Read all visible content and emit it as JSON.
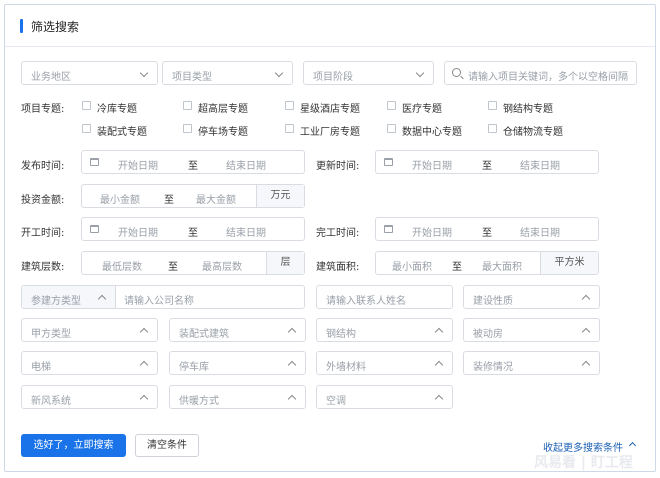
{
  "panel": {
    "title": "筛选搜索"
  },
  "top_selects": {
    "region": "业务地区",
    "project_type": "项目类型",
    "project_stage": "项目阶段"
  },
  "keyword_search": {
    "placeholder": "请输入项目关键词，多个以空格间隔"
  },
  "topics": {
    "label": "项目专题:",
    "items": [
      "冷库专题",
      "超高层专题",
      "星级酒店专题",
      "医疗专题",
      "钢结构专题",
      "装配式专题",
      "停车场专题",
      "工业厂房专题",
      "数据中心专题",
      "仓储物流专题"
    ]
  },
  "publish_time": {
    "label": "发布时间:",
    "start": "开始日期",
    "sep": "至",
    "end": "结束日期"
  },
  "update_time": {
    "label": "更新时间:",
    "start": "开始日期",
    "sep": "至",
    "end": "结束日期"
  },
  "investment": {
    "label": "投资金额:",
    "min": "最小金额",
    "sep": "至",
    "max": "最大金额",
    "unit": "万元"
  },
  "start_time": {
    "label": "开工时间:",
    "start": "开始日期",
    "sep": "至",
    "end": "结束日期"
  },
  "finish_time": {
    "label": "完工时间:",
    "start": "开始日期",
    "sep": "至",
    "end": "结束日期"
  },
  "floors": {
    "label": "建筑层数:",
    "min": "最低层数",
    "sep": "至",
    "max": "最高层数",
    "unit": "层"
  },
  "area": {
    "label": "建筑面积:",
    "min": "最小面积",
    "sep": "至",
    "max": "最大面积",
    "unit": "平方米"
  },
  "participant": {
    "type": "参建方类型",
    "company_placeholder": "请输入公司名称",
    "contact_placeholder": "请输入联系人姓名",
    "nature": "建设性质"
  },
  "filter_selects": {
    "owner_type": "甲方类型",
    "prefab": "装配式建筑",
    "steel": "钢结构",
    "passive": "被动房",
    "elevator": "电梯",
    "garage": "停车库",
    "facade": "外墙材料",
    "decoration": "装修情况",
    "fresh_air": "新风系统",
    "heating": "供暖方式",
    "aircon": "空调"
  },
  "actions": {
    "search": "选好了，立即搜索",
    "clear": "清空条件",
    "collapse": "收起更多搜索条件"
  },
  "watermark": "风易看 | 盯工程"
}
